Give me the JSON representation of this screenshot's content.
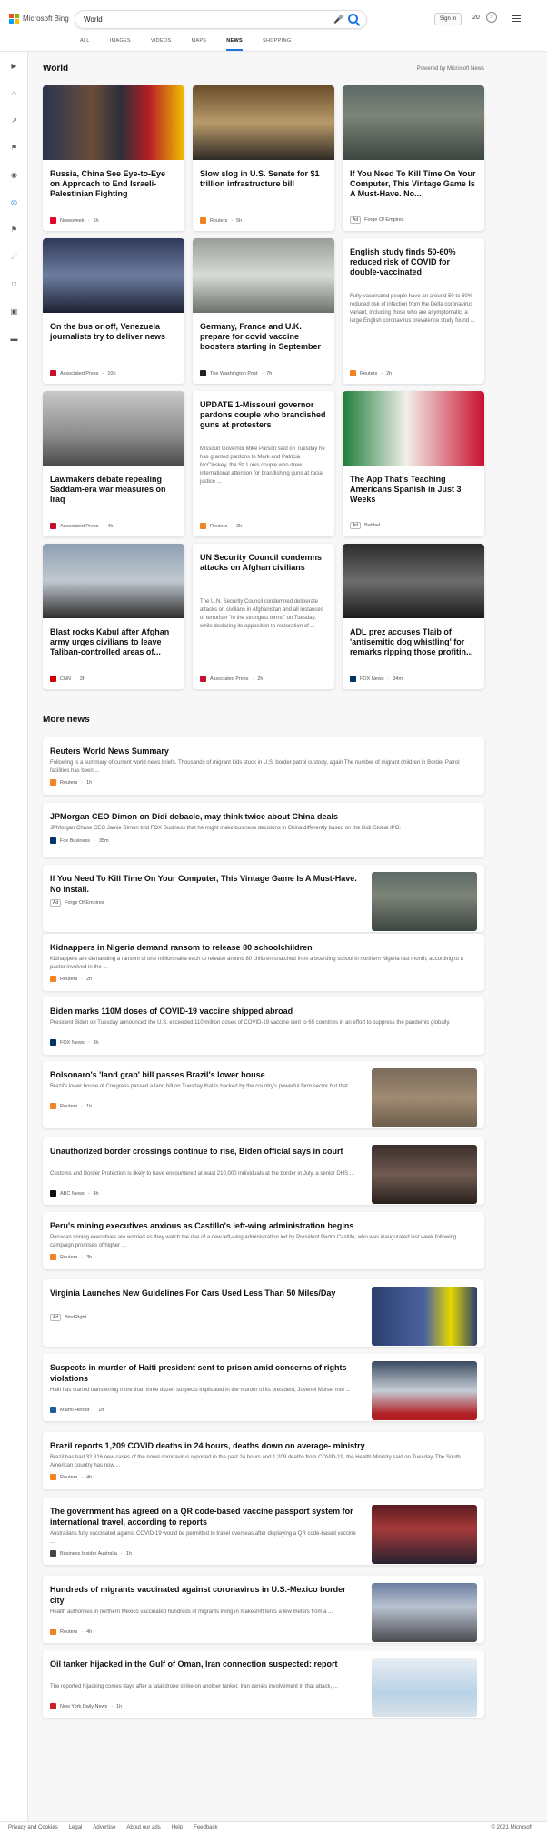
{
  "header": {
    "brand": "Microsoft Bing",
    "query": "World",
    "signin": "Sign in",
    "points": "20",
    "tabs": [
      "ALL",
      "IMAGES",
      "VIDEOS",
      "MAPS",
      "NEWS",
      "SHOPPING"
    ]
  },
  "section": {
    "title": "World",
    "powered": "Powered by Microsoft News"
  },
  "cards": [
    {
      "title": "Russia, China See Eye-to-Eye on Approach to End Israeli-Palestinian Fighting",
      "snippet": "",
      "source": "Newsweek",
      "time": "1h",
      "ad": false,
      "img": "photo"
    },
    {
      "title": "Slow slog in U.S. Senate for $1 trillion infrastructure bill",
      "snippet": "",
      "source": "Reuters",
      "time": "5h",
      "ad": false,
      "img": "photo"
    },
    {
      "title": "If You Need To Kill Time On Your Computer, This Vintage Game Is A Must-Have. No...",
      "snippet": "",
      "source": "Forge Of Empires",
      "time": "",
      "ad": true,
      "ad_label": "Ad",
      "img": "photo"
    },
    {
      "title": "On the bus or off, Venezuela journalists try to deliver news",
      "snippet": "",
      "source": "Associated Press",
      "time": "10h",
      "ad": false,
      "img": "photo"
    },
    {
      "title": "Germany, France and U.K. prepare for covid vaccine boosters starting in September",
      "snippet": "",
      "source": "The Washington Post",
      "time": "7h",
      "ad": false,
      "img": "photo"
    },
    {
      "title": "English study finds 50-60% reduced risk of COVID for double-vaccinated",
      "snippet": "Fully-vaccinated people have an around 50 to 60% reduced risk of infection from the Delta coronavirus variant, including those who are asymptomatic, a large English coronavirus prevalence study found ...",
      "source": "Reuters",
      "time": "2h",
      "ad": false,
      "img": "none"
    },
    {
      "title": "Lawmakers debate repealing Saddam-era war measures on Iraq",
      "snippet": "",
      "source": "Associated Press",
      "time": "4h",
      "ad": false,
      "img": "photo"
    },
    {
      "title": "UPDATE 1-Missouri governor pardons couple who brandished guns at protesters",
      "snippet": "Missouri Governor Mike Parson said on Tuesday he has granted pardons to Mark and Patricia McCloskey, the St. Louis couple who drew international attention for brandishing guns at racial justice ...",
      "source": "Reuters",
      "time": "2h",
      "ad": false,
      "img": "none"
    },
    {
      "title": "The App That's Teaching Americans Spanish in Just 3 Weeks",
      "snippet": "",
      "source": "Babbel",
      "time": "",
      "ad": true,
      "ad_label": "Ad",
      "img": "photo"
    },
    {
      "title": "Blast rocks Kabul after Afghan army urges civilians to leave Taliban-controlled areas of...",
      "snippet": "",
      "source": "CNN",
      "time": "3h",
      "ad": false,
      "img": "photo"
    },
    {
      "title": "UN Security Council condemns attacks on Afghan civilians",
      "snippet": "The U.N. Security Council condemned deliberate attacks on civilians in Afghanistan and all instances of terrorism \"in the strongest terms\" on Tuesday, while declaring its opposition to restoration of ...",
      "source": "Associated Press",
      "time": "2h",
      "ad": false,
      "img": "none"
    },
    {
      "title": "ADL prez accuses Tlaib of 'antisemitic dog whistling' for remarks ripping those profitin...",
      "snippet": "",
      "source": "FOX News",
      "time": "34m",
      "ad": false,
      "img": "photo"
    }
  ],
  "more": {
    "title": "More news",
    "items": [
      {
        "title": "Reuters World News Summary",
        "snippet": "Following is a summary of current world news briefs. Thousands of migrant kids stuck in U.S. border patrol custody, again The number of migrant children in Border Patrol facilities has been ...",
        "source": "Reuters",
        "time": "1h",
        "ad": false,
        "thumb": false
      },
      {
        "title": "JPMorgan CEO Dimon on Didi debacle, may think twice about China deals",
        "snippet": "JPMorgan Chase CEO Jamie Dimon told FOX Business that he might make business decisions in China differently based on the Didi Global IPO.",
        "source": "Fox Business",
        "time": "35m",
        "ad": false,
        "thumb": false
      },
      {
        "title": "If You Need To Kill Time On Your Computer, This Vintage Game Is A Must-Have. No Install.",
        "snippet": "",
        "source": "Forge Of Empires",
        "time": "",
        "ad": true,
        "ad_label": "Ad",
        "thumb": true
      },
      {
        "title": "Kidnappers in Nigeria demand ransom to release 80 schoolchildren",
        "snippet": "Kidnappers are demanding a ransom of one million naira each to release around 80 children snatched from a boarding school in northern Nigeria last month, according to a pastor involved in the ...",
        "source": "Reuters",
        "time": "2h",
        "ad": false,
        "thumb": false
      },
      {
        "title": "Biden marks 110M doses of COVID-19 vaccine shipped abroad",
        "snippet": "President Biden on Tuesday announced the U.S. exceeded 110 million doses of COVID-19 vaccine sent to 65 countries in an effort to suppress the pandemic globally.",
        "source": "FOX News",
        "time": "3h",
        "ad": false,
        "thumb": false
      },
      {
        "title": "Bolsonaro's 'land grab' bill passes Brazil's lower house",
        "snippet": "Brazil's lower house of Congress passed a land bill on Tuesday that is backed by the country's powerful farm sector but that ...",
        "source": "Reuters",
        "time": "1h",
        "ad": false,
        "thumb": true
      },
      {
        "title": "Unauthorized border crossings continue to rise, Biden official says in court",
        "snippet": "Customs and Border Protection is likely to have encountered at least 210,000 individuals at the border in July, a senior DHS ...",
        "source": "ABC News",
        "time": "4h",
        "ad": false,
        "thumb": true
      },
      {
        "title": "Peru's mining executives anxious as Castillo's left-wing administration begins",
        "snippet": "Peruvian mining executives are worried as they watch the rise of a new left-wing administration led by President Pedro Castillo, who was inaugurated last week following campaign promises of higher ...",
        "source": "Reuters",
        "time": "3h",
        "ad": false,
        "thumb": false
      },
      {
        "title": "Virginia Launches New Guidelines For Cars Used Less Than 50 Miles/Day",
        "snippet": "",
        "source": "BindRight",
        "time": "",
        "ad": true,
        "ad_label": "Ad",
        "thumb": true
      },
      {
        "title": "Suspects in murder of Haiti president sent to prison amid concerns of rights violations",
        "snippet": "Haiti has started transferring more than three dozen suspects implicated in the murder of its president, Jovenel Moise, into ...",
        "source": "Miami Herald",
        "time": "1h",
        "ad": false,
        "thumb": true
      },
      {
        "title": "Brazil reports 1,209 COVID deaths in 24 hours, deaths down on average- ministry",
        "snippet": "Brazil has had 32,316 new cases of the novel coronavirus reported in the past 24 hours and 1,209 deaths from COVID-19, the Health Ministry said on Tuesday. The South American country has now ...",
        "source": "Reuters",
        "time": "4h",
        "ad": false,
        "thumb": false
      },
      {
        "title": "The government has agreed on a QR code-based vaccine passport system for international travel, according to reports",
        "snippet": "Australians fully vaccinated against COVID-19 would be permitted to travel overseas after displaying a QR code-based vaccine ...",
        "source": "Business Insider Australia",
        "time": "1h",
        "ad": false,
        "thumb": true
      },
      {
        "title": "Hundreds of migrants vaccinated against coronavirus in U.S.-Mexico border city",
        "snippet": "Health authorities in northern Mexico vaccinated hundreds of migrants living in makeshift tents a few meters from a ...",
        "source": "Reuters",
        "time": "4h",
        "ad": false,
        "thumb": true
      },
      {
        "title": "Oil tanker hijacked in the Gulf of Oman, Iran connection suspected: report",
        "snippet": "The reported hijacking comes days after a fatal drone strike on another tanker. Iran denies involvement in that attack, ...",
        "source": "New York Daily News",
        "time": "1h",
        "ad": false,
        "thumb": true
      }
    ]
  },
  "footer": {
    "links": [
      "Privacy and Cookies",
      "Legal",
      "Advertise",
      "About our ads",
      "Help",
      "Feedback"
    ],
    "copyright": "© 2021 Microsoft"
  }
}
